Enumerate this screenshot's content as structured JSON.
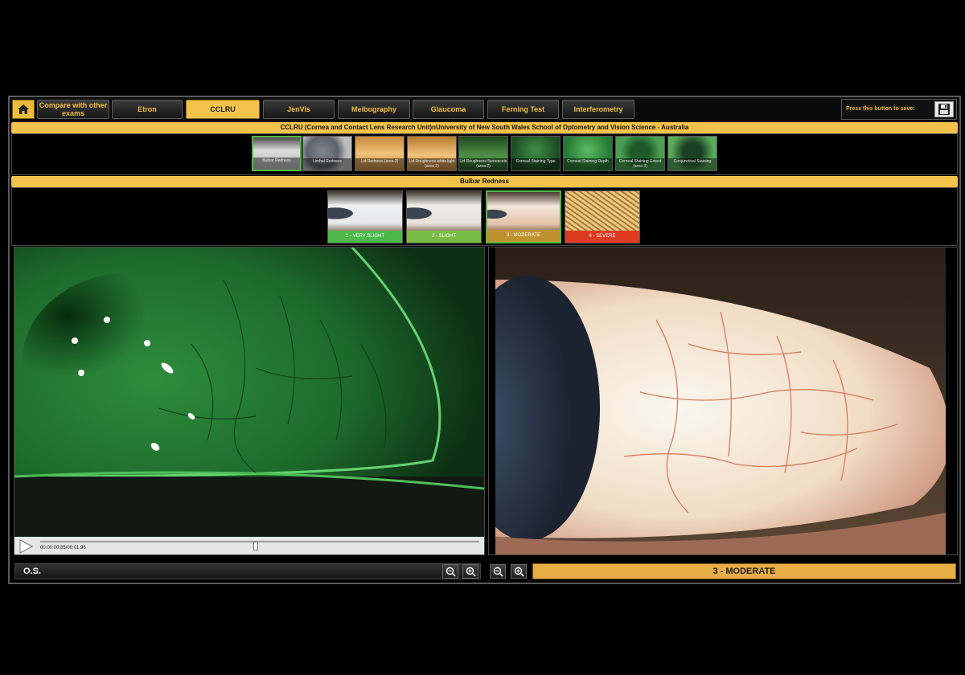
{
  "tabs": [
    {
      "label": "Compare with other exams"
    },
    {
      "label": "Etron"
    },
    {
      "label": "CCLRU",
      "active": true
    },
    {
      "label": "JenVis"
    },
    {
      "label": "Meibography"
    },
    {
      "label": "Glaucoma"
    },
    {
      "label": "Ferning Test"
    },
    {
      "label": "Interferometry"
    }
  ],
  "save": {
    "label": "Press this button to save:",
    "icon": "floppy-disk-icon"
  },
  "home_icon": "home-icon",
  "header": {
    "title": "CCLRU (Cornea and Contact Lens Research Unit)nUniversity of New South Wales School of Optometry and Vision Science - Australia"
  },
  "categories": [
    {
      "label": "Bulbar Redness",
      "selected": true
    },
    {
      "label": "Limbal Redness"
    },
    {
      "label": "Lid Redness (area 2)"
    },
    {
      "label": "Lid Roughness white light (area 2)"
    },
    {
      "label": "Lid Roughness fluorescein (area 2)"
    },
    {
      "label": "Corneal Staining Type"
    },
    {
      "label": "Corneal Staining Depth"
    },
    {
      "label": "Corneal Staining Extent (area 3)"
    },
    {
      "label": "Conjunctival Staining"
    }
  ],
  "section": {
    "title": "Bulbar Redness"
  },
  "grades": [
    {
      "label": "1 - VERY SLIGHT",
      "color": "#4db84a"
    },
    {
      "label": "2 - SLIGHT",
      "color": "#79bc45"
    },
    {
      "label": "3 - MODERATE",
      "color": "#c0922e",
      "selected": true
    },
    {
      "label": "4 - SEVERE",
      "color": "#dd3a22"
    }
  ],
  "video": {
    "timecode": "00:00:00.85/00:01.96",
    "progress": 0.49
  },
  "eye": {
    "label": "O.S."
  },
  "result": {
    "label": "3 - MODERATE"
  },
  "colors": {
    "accent": "#f3c24a",
    "selected_border": "#52b848"
  }
}
